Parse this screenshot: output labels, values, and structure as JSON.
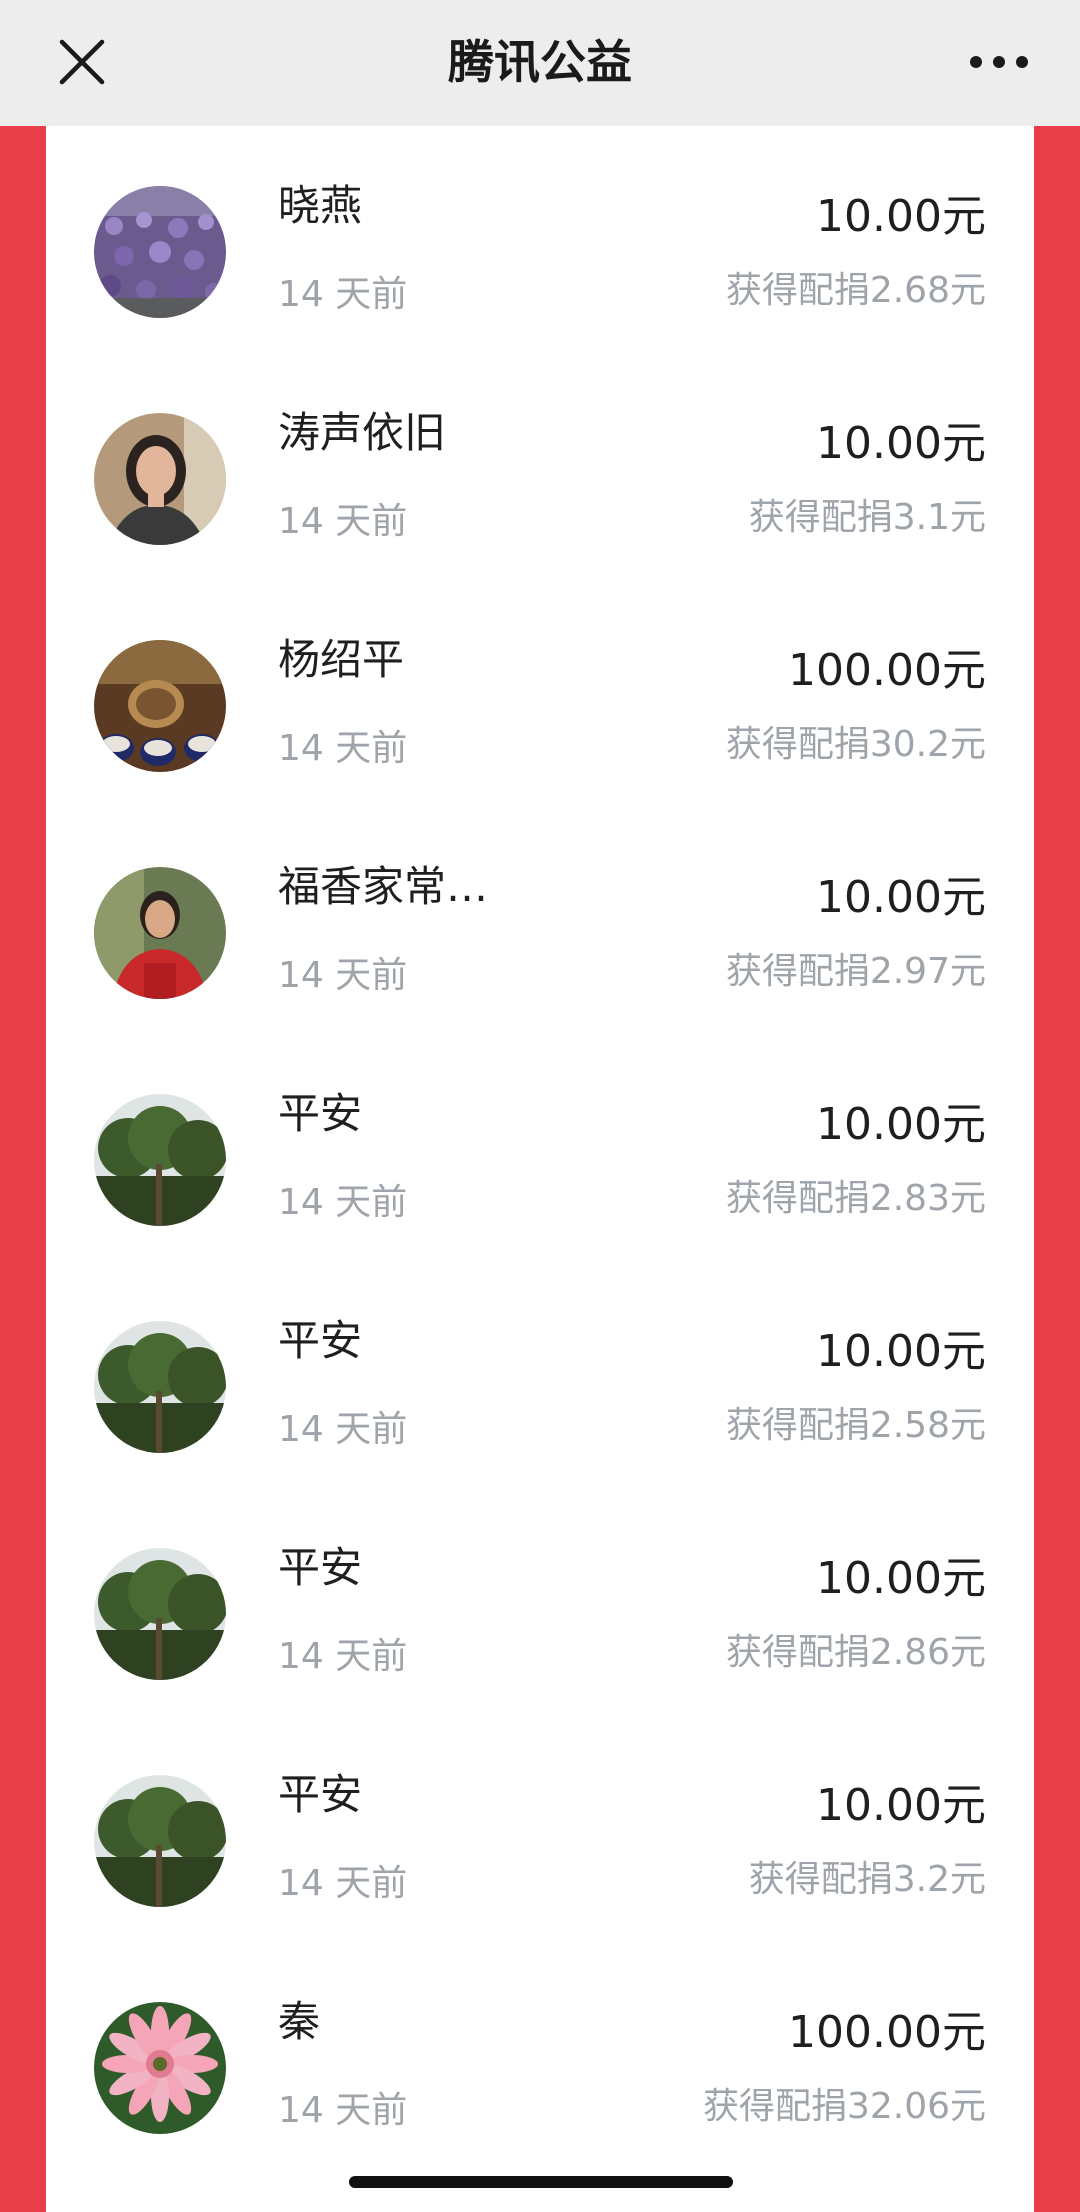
{
  "header": {
    "title": "腾讯公益",
    "close_icon": "close-icon",
    "more_icon": "more-dots-icon"
  },
  "colors": {
    "accent_red": "#e83e4a",
    "titlebar_bg": "#ededed",
    "primary_text": "#1f1f1f",
    "secondary_text": "#9ea4aa"
  },
  "donations": [
    {
      "name": "晓燕",
      "time": "14 天前",
      "amount": "10.00元",
      "match": "获得配捐2.68元",
      "avatar": "lavender-field-avatar"
    },
    {
      "name": "涛声依旧",
      "time": "14 天前",
      "amount": "10.00元",
      "match": "获得配捐3.1元",
      "avatar": "woman-portrait-avatar"
    },
    {
      "name": "杨绍平",
      "time": "14 天前",
      "amount": "100.00元",
      "match": "获得配捐30.2元",
      "avatar": "tea-set-avatar"
    },
    {
      "name": "福香家常…",
      "time": "14 天前",
      "amount": "10.00元",
      "match": "获得配捐2.97元",
      "avatar": "woman-red-apron-avatar"
    },
    {
      "name": "平安",
      "time": "14 天前",
      "amount": "10.00元",
      "match": "获得配捐2.83元",
      "avatar": "tree-avatar"
    },
    {
      "name": "平安",
      "time": "14 天前",
      "amount": "10.00元",
      "match": "获得配捐2.58元",
      "avatar": "tree-avatar"
    },
    {
      "name": "平安",
      "time": "14 天前",
      "amount": "10.00元",
      "match": "获得配捐2.86元",
      "avatar": "tree-avatar"
    },
    {
      "name": "平安",
      "time": "14 天前",
      "amount": "10.00元",
      "match": "获得配捐3.2元",
      "avatar": "tree-avatar"
    },
    {
      "name": "秦",
      "time": "14 天前",
      "amount": "100.00元",
      "match": "获得配捐32.06元",
      "avatar": "pink-gerbera-avatar"
    }
  ]
}
